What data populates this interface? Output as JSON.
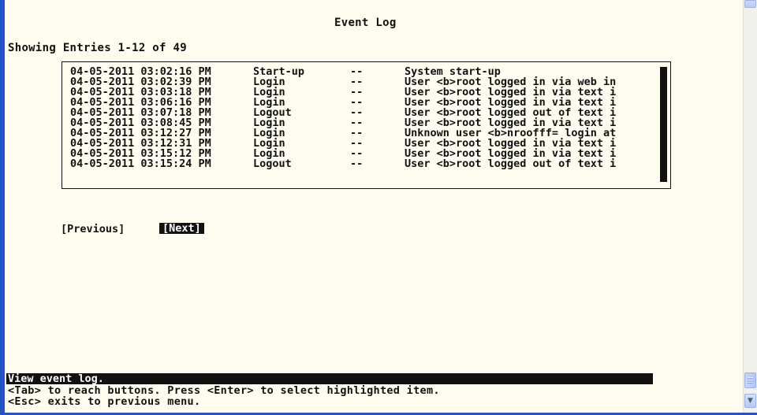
{
  "title": "Event Log",
  "showing": "Showing Entries 1-12 of 49",
  "log": [
    {
      "date": "04-05-2011 03:02:16 PM",
      "type": "Start-up",
      "dash": "--",
      "message": "System start-up"
    },
    {
      "date": "04-05-2011 03:02:39 PM",
      "type": "Login",
      "dash": "--",
      "message": "User <b>root logged in via web in"
    },
    {
      "date": "04-05-2011 03:03:18 PM",
      "type": "Login",
      "dash": "--",
      "message": "User <b>root logged in via text i"
    },
    {
      "date": "04-05-2011 03:06:16 PM",
      "type": "Login",
      "dash": "--",
      "message": "User <b>root logged in via text i"
    },
    {
      "date": "04-05-2011 03:07:18 PM",
      "type": "Logout",
      "dash": "--",
      "message": "User <b>root logged out of text i"
    },
    {
      "date": "04-05-2011 03:08:45 PM",
      "type": "Login",
      "dash": "--",
      "message": "User <b>root logged in via text i"
    },
    {
      "date": "04-05-2011 03:12:27 PM",
      "type": "Login",
      "dash": "--",
      "message": "Unknown user <b>nroofff= login at"
    },
    {
      "date": "04-05-2011 03:12:31 PM",
      "type": "Login",
      "dash": "--",
      "message": "User <b>root logged in via text i"
    },
    {
      "date": "04-05-2011 03:15:12 PM",
      "type": "Login",
      "dash": "--",
      "message": "User <b>root logged in via text i"
    },
    {
      "date": "04-05-2011 03:15:24 PM",
      "type": "Logout",
      "dash": "--",
      "message": "User <b>root logged out of text i"
    }
  ],
  "buttons": {
    "previous": "[Previous]",
    "next": "[Next]"
  },
  "status": "View event log.",
  "help": [
    "<Tab> to reach buttons. Press <Enter> to select highlighted item.",
    "<Esc> exits to previous menu."
  ],
  "colors": {
    "background": "#fefdf0",
    "text": "#111111",
    "highlight_bg": "#111111",
    "highlight_text": "#ffffff",
    "window_border": "#2452c8"
  },
  "icons": {
    "scroll_down": "chevron-down-icon",
    "scroll_grip": "grip-icon"
  }
}
